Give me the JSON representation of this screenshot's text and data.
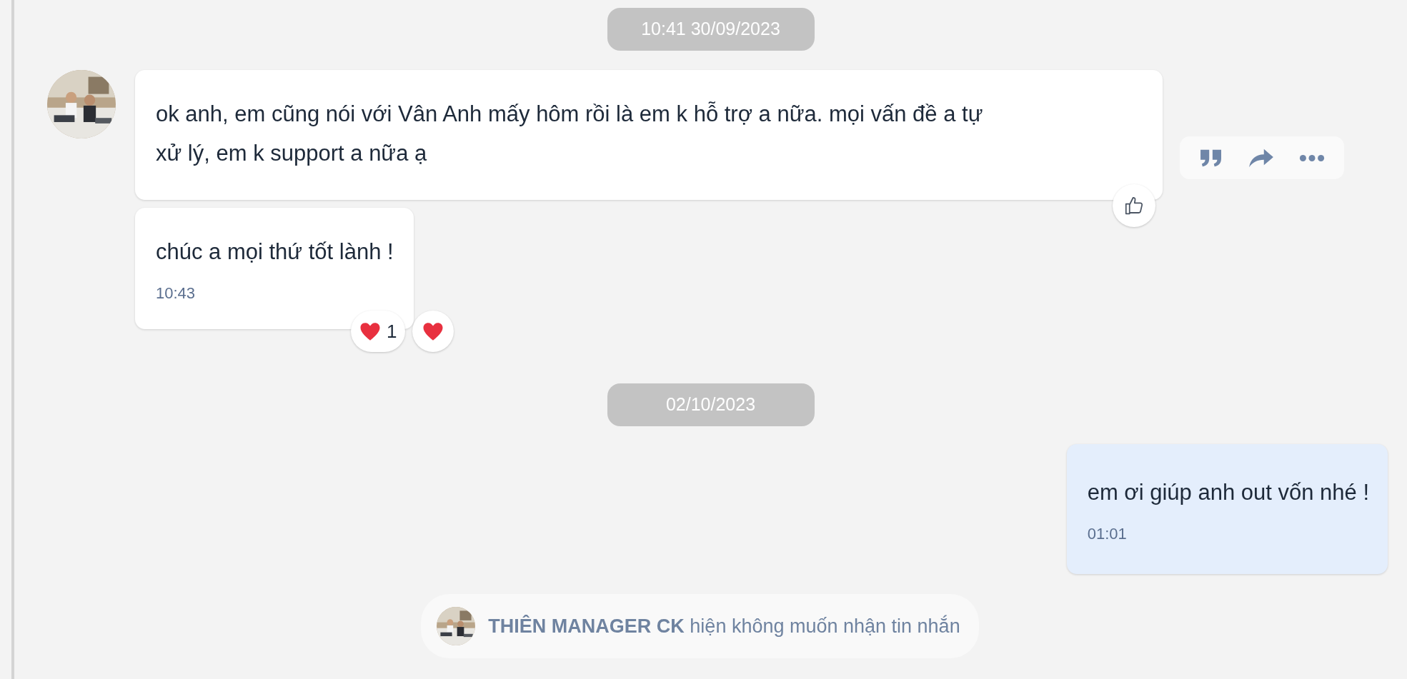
{
  "conversation": [
    {
      "kind": "date",
      "text": "10:41 30/09/2023"
    },
    {
      "kind": "incoming",
      "messages": [
        {
          "text": "ok anh, em cũng nói với Vân Anh mấy hôm rồi là em k hỗ trợ a nữa. mọi vấn đề a tự xử lý, em k support a nữa ạ",
          "hovered": true,
          "like_button": true
        },
        {
          "text": "chúc a mọi thứ tốt lành !",
          "time": "10:43",
          "reaction": {
            "count": "1"
          }
        }
      ]
    },
    {
      "kind": "date",
      "text": "02/10/2023"
    },
    {
      "kind": "outgoing",
      "messages": [
        {
          "text": "em ơi giúp anh out vốn nhé !",
          "time": "01:01"
        }
      ]
    },
    {
      "kind": "notice",
      "text": "**THIÊN MANAGER CK** hiện không muốn nhận tin nhắn"
    }
  ]
}
